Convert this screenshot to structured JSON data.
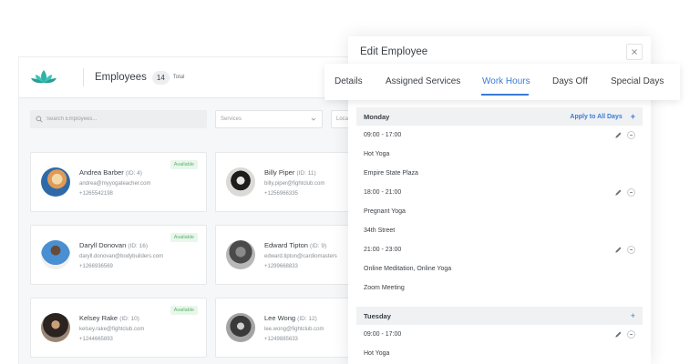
{
  "app": {
    "title": "Employees",
    "count": "14",
    "count_label": "Total",
    "search_placeholder": "Search Employees...",
    "services_placeholder": "Services",
    "location_placeholder": "Loca"
  },
  "employees": [
    {
      "name": "Andrea Barber",
      "id": "(ID: 4)",
      "email": "andrea@myyogateacher.com",
      "phone": "+1265542198",
      "status": "Available"
    },
    {
      "name": "Billy Piper",
      "id": "(ID: 11)",
      "email": "billy.piper@fightclub.com",
      "phone": "+1256966335",
      "status": ""
    },
    {
      "name": "Daryll Donovan",
      "id": "(ID: 16)",
      "email": "daryll.donovan@bodybuilders.com",
      "phone": "+1266936569",
      "status": "Available"
    },
    {
      "name": "Edward Tipton",
      "id": "(ID: 9)",
      "email": "edward.tipton@cardiomasters",
      "phone": "+1299668833",
      "status": ""
    },
    {
      "name": "Kelsey Rake",
      "id": "(ID: 10)",
      "email": "kelsey.rake@fightclub.com",
      "phone": "+1244665893",
      "status": "Available"
    },
    {
      "name": "Lee Wong",
      "id": "(ID: 12)",
      "email": "lee.wong@fightclub.com",
      "phone": "+1249885633",
      "status": ""
    }
  ],
  "modal": {
    "title": "Edit Employee",
    "tabs": [
      "Details",
      "Assigned Services",
      "Work Hours",
      "Days Off",
      "Special Days"
    ],
    "active_tab": "Work Hours",
    "apply_all": "Apply to All Days",
    "monday": {
      "name": "Monday",
      "slots": [
        {
          "time": "09:00 - 17:00",
          "service": "Hot Yoga",
          "location": "Empire State Plaza"
        },
        {
          "time": "18:00 - 21:00",
          "service": "Pregnant Yoga",
          "location": "34th Street"
        },
        {
          "time": "21:00 - 23:00",
          "service": "Online Meditation, Online Yoga",
          "location": "Zoom Meeting"
        }
      ]
    },
    "tuesday": {
      "name": "Tuesday",
      "slots": [
        {
          "time": "09:00 - 17:00",
          "service": "Hot Yoga"
        }
      ]
    }
  },
  "colors": {
    "accent": "#3a7bd5",
    "available": "#5bb46a",
    "logo": "#2bb3a8"
  },
  "icons": [
    "lotus-logo-icon",
    "search-icon",
    "chevron-down-icon",
    "close-icon",
    "edit-pencil-icon",
    "remove-circle-icon",
    "plus-icon"
  ]
}
